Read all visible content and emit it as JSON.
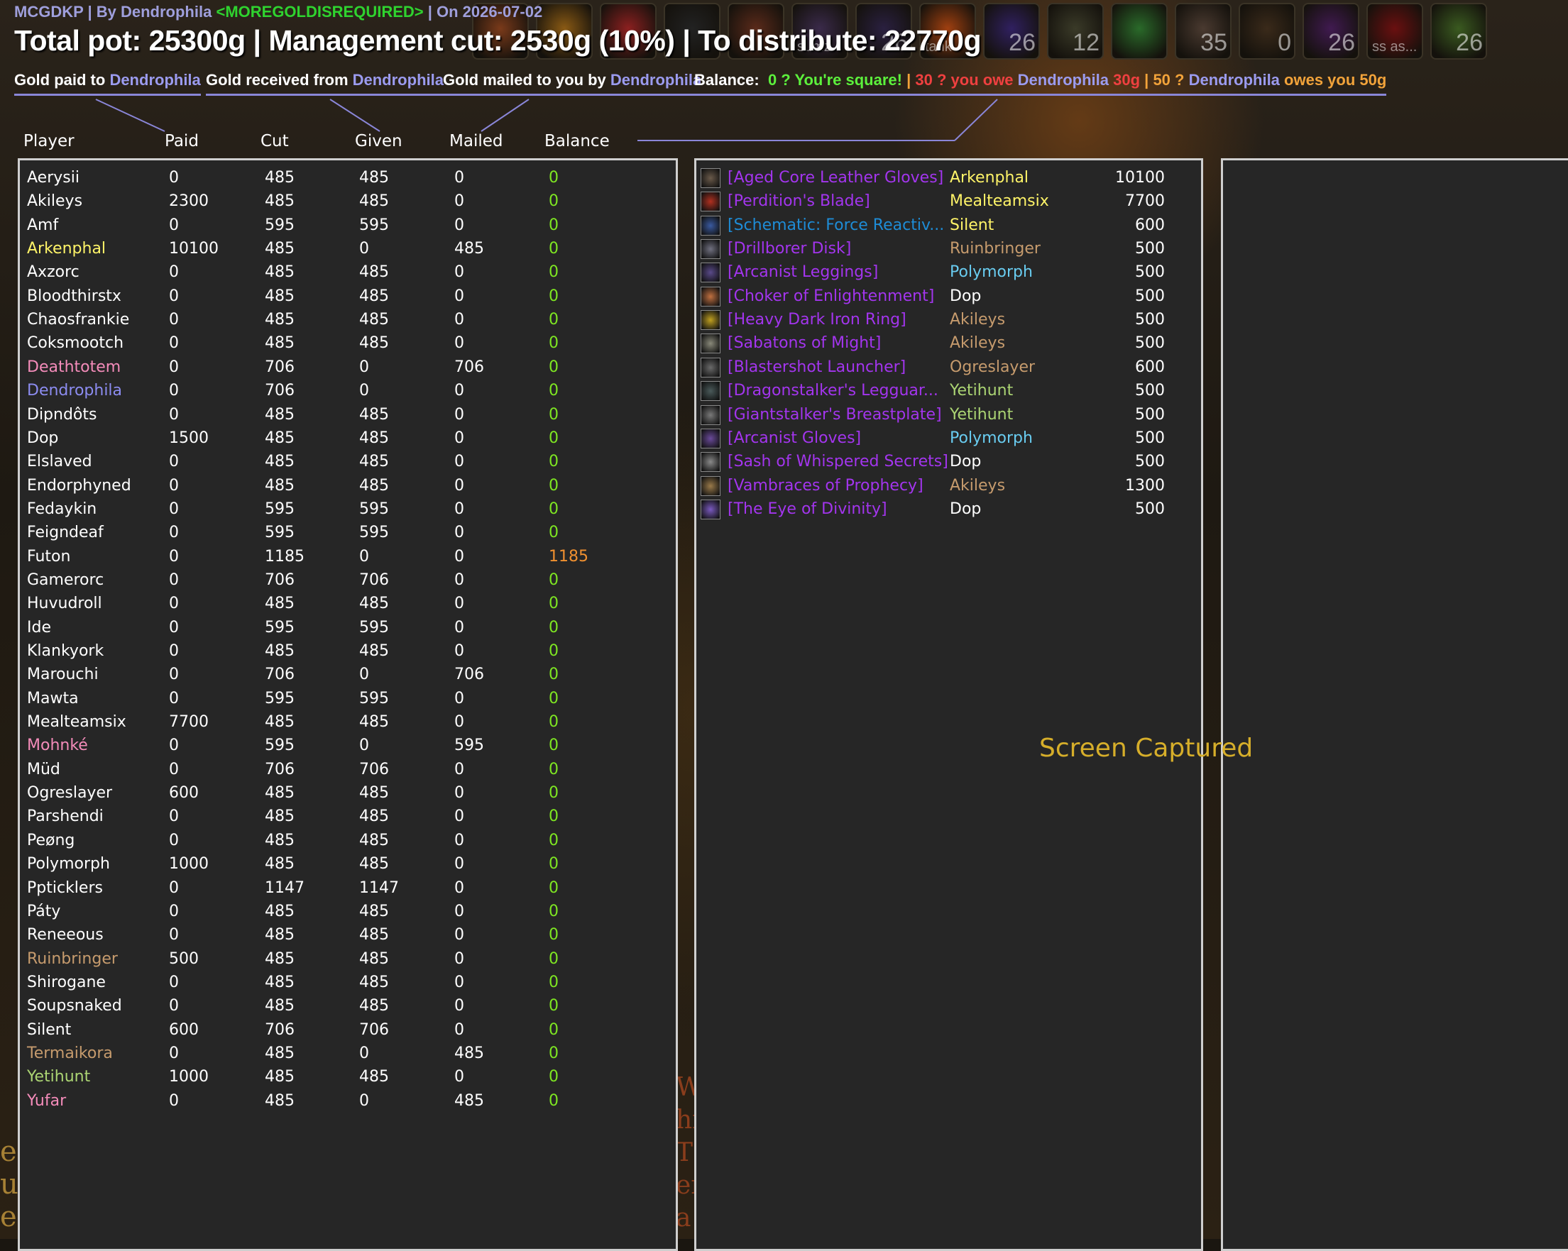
{
  "header": {
    "addon": "MCGDKP | By Dendrophila",
    "guild": "<MOREGOLDISREQUIRED>",
    "date": "| On 2026-07-02",
    "totals": "Total pot: 25300g | Management cut: 2530g (10%) | To distribute: 22770g"
  },
  "action_bar": [
    {
      "label": "",
      "tag": "",
      "color": "#7a3a1a"
    },
    {
      "label": "",
      "tag": "",
      "color": "#8a5a14"
    },
    {
      "label": "",
      "tag": "",
      "color": "#8c2020"
    },
    {
      "label": "",
      "tag": "",
      "color": "#222"
    },
    {
      "label": "",
      "tag": "",
      "color": "#5a2a1a"
    },
    {
      "label": "",
      "tag": "sumz",
      "color": "#3a2a4a"
    },
    {
      "label": "26",
      "tag": "",
      "color": "#2a2040"
    },
    {
      "label": "",
      "tag": "tank",
      "color": "#a04010"
    },
    {
      "label": "26",
      "tag": "",
      "color": "#302060"
    },
    {
      "label": "12",
      "tag": "",
      "color": "#3a3a28"
    },
    {
      "label": "",
      "tag": "",
      "color": "#2a6a2a"
    },
    {
      "label": "35",
      "tag": "",
      "color": "#4a3a30"
    },
    {
      "label": "0",
      "tag": "",
      "color": "#3a2a1a"
    },
    {
      "label": "26",
      "tag": "",
      "color": "#401a50"
    },
    {
      "label": "",
      "tag": "ss as...",
      "color": "#6a1010"
    },
    {
      "label": "26",
      "tag": "",
      "color": "#3a5a20"
    }
  ],
  "legend": {
    "paid_prefix": "Gold paid to ",
    "received_prefix": "Gold received from ",
    "mailed_prefix": "Gold mailed to you by ",
    "officer": "Dendrophila",
    "balance_label": "Balance:",
    "square": "0 ? You're square!",
    "sep": "|",
    "owe_a": "30 ? you owe ",
    "owe_b": " 30g",
    "owes_a": "50 ? ",
    "owes_b": " owes you 50g"
  },
  "columns": {
    "player": "Player",
    "paid": "Paid",
    "cut": "Cut",
    "given": "Given",
    "mailed": "Mailed",
    "balance": "Balance"
  },
  "players": [
    {
      "name": "Aerysii",
      "color": "#ffffff",
      "paid": "0",
      "cut": "485",
      "given": "485",
      "mailed": "0",
      "balance": "0"
    },
    {
      "name": "Akileys",
      "color": "#ffffff",
      "paid": "2300",
      "cut": "485",
      "given": "485",
      "mailed": "0",
      "balance": "0"
    },
    {
      "name": "Amf",
      "color": "#ffffff",
      "paid": "0",
      "cut": "595",
      "given": "595",
      "mailed": "0",
      "balance": "0"
    },
    {
      "name": "Arkenphal",
      "color": "#fff468",
      "paid": "10100",
      "cut": "485",
      "given": "0",
      "mailed": "485",
      "balance": "0"
    },
    {
      "name": "Axzorc",
      "color": "#ffffff",
      "paid": "0",
      "cut": "485",
      "given": "485",
      "mailed": "0",
      "balance": "0"
    },
    {
      "name": "Bloodthirstx",
      "color": "#ffffff",
      "paid": "0",
      "cut": "485",
      "given": "485",
      "mailed": "0",
      "balance": "0"
    },
    {
      "name": "Chaosfrankie",
      "color": "#ffffff",
      "paid": "0",
      "cut": "485",
      "given": "485",
      "mailed": "0",
      "balance": "0"
    },
    {
      "name": "Coksmootch",
      "color": "#ffffff",
      "paid": "0",
      "cut": "485",
      "given": "485",
      "mailed": "0",
      "balance": "0"
    },
    {
      "name": "Deathtotem",
      "color": "#f48cba",
      "paid": "0",
      "cut": "706",
      "given": "0",
      "mailed": "706",
      "balance": "0"
    },
    {
      "name": "Dendrophila",
      "color": "#8c8cf0",
      "paid": "0",
      "cut": "706",
      "given": "0",
      "mailed": "0",
      "balance": "0"
    },
    {
      "name": "Dipndôts",
      "color": "#ffffff",
      "paid": "0",
      "cut": "485",
      "given": "485",
      "mailed": "0",
      "balance": "0"
    },
    {
      "name": "Dop",
      "color": "#ffffff",
      "paid": "1500",
      "cut": "485",
      "given": "485",
      "mailed": "0",
      "balance": "0"
    },
    {
      "name": "Elslaved",
      "color": "#ffffff",
      "paid": "0",
      "cut": "485",
      "given": "485",
      "mailed": "0",
      "balance": "0"
    },
    {
      "name": "Endorphyned",
      "color": "#ffffff",
      "paid": "0",
      "cut": "485",
      "given": "485",
      "mailed": "0",
      "balance": "0"
    },
    {
      "name": "Fedaykin",
      "color": "#ffffff",
      "paid": "0",
      "cut": "595",
      "given": "595",
      "mailed": "0",
      "balance": "0"
    },
    {
      "name": "Feigndeaf",
      "color": "#ffffff",
      "paid": "0",
      "cut": "595",
      "given": "595",
      "mailed": "0",
      "balance": "0"
    },
    {
      "name": "Futon",
      "color": "#ffffff",
      "paid": "0",
      "cut": "1185",
      "given": "0",
      "mailed": "0",
      "balance": "1185"
    },
    {
      "name": "Gamerorc",
      "color": "#ffffff",
      "paid": "0",
      "cut": "706",
      "given": "706",
      "mailed": "0",
      "balance": "0"
    },
    {
      "name": "Huvudroll",
      "color": "#ffffff",
      "paid": "0",
      "cut": "485",
      "given": "485",
      "mailed": "0",
      "balance": "0"
    },
    {
      "name": "Ide",
      "color": "#ffffff",
      "paid": "0",
      "cut": "595",
      "given": "595",
      "mailed": "0",
      "balance": "0"
    },
    {
      "name": "Klankyork",
      "color": "#ffffff",
      "paid": "0",
      "cut": "485",
      "given": "485",
      "mailed": "0",
      "balance": "0"
    },
    {
      "name": "Marouchi",
      "color": "#ffffff",
      "paid": "0",
      "cut": "706",
      "given": "0",
      "mailed": "706",
      "balance": "0"
    },
    {
      "name": "Mawta",
      "color": "#ffffff",
      "paid": "0",
      "cut": "595",
      "given": "595",
      "mailed": "0",
      "balance": "0"
    },
    {
      "name": "Mealteamsix",
      "color": "#ffffff",
      "paid": "7700",
      "cut": "485",
      "given": "485",
      "mailed": "0",
      "balance": "0"
    },
    {
      "name": "Mohnké",
      "color": "#f48cba",
      "paid": "0",
      "cut": "595",
      "given": "0",
      "mailed": "595",
      "balance": "0"
    },
    {
      "name": "Müd",
      "color": "#ffffff",
      "paid": "0",
      "cut": "706",
      "given": "706",
      "mailed": "0",
      "balance": "0"
    },
    {
      "name": "Ogreslayer",
      "color": "#ffffff",
      "paid": "600",
      "cut": "485",
      "given": "485",
      "mailed": "0",
      "balance": "0"
    },
    {
      "name": "Parshendi",
      "color": "#ffffff",
      "paid": "0",
      "cut": "485",
      "given": "485",
      "mailed": "0",
      "balance": "0"
    },
    {
      "name": "Peøng",
      "color": "#ffffff",
      "paid": "0",
      "cut": "485",
      "given": "485",
      "mailed": "0",
      "balance": "0"
    },
    {
      "name": "Polymorph",
      "color": "#ffffff",
      "paid": "1000",
      "cut": "485",
      "given": "485",
      "mailed": "0",
      "balance": "0"
    },
    {
      "name": "Ppticklers",
      "color": "#ffffff",
      "paid": "0",
      "cut": "1147",
      "given": "1147",
      "mailed": "0",
      "balance": "0"
    },
    {
      "name": "Páty",
      "color": "#ffffff",
      "paid": "0",
      "cut": "485",
      "given": "485",
      "mailed": "0",
      "balance": "0"
    },
    {
      "name": "Reneeous",
      "color": "#ffffff",
      "paid": "0",
      "cut": "485",
      "given": "485",
      "mailed": "0",
      "balance": "0"
    },
    {
      "name": "Ruinbringer",
      "color": "#c69b6d",
      "paid": "500",
      "cut": "485",
      "given": "485",
      "mailed": "0",
      "balance": "0"
    },
    {
      "name": "Shirogane",
      "color": "#ffffff",
      "paid": "0",
      "cut": "485",
      "given": "485",
      "mailed": "0",
      "balance": "0"
    },
    {
      "name": "Soupsnaked",
      "color": "#ffffff",
      "paid": "0",
      "cut": "485",
      "given": "485",
      "mailed": "0",
      "balance": "0"
    },
    {
      "name": "Silent",
      "color": "#ffffff",
      "paid": "600",
      "cut": "706",
      "given": "706",
      "mailed": "0",
      "balance": "0"
    },
    {
      "name": "Termaikora",
      "color": "#c69b6d",
      "paid": "0",
      "cut": "485",
      "given": "0",
      "mailed": "485",
      "balance": "0"
    },
    {
      "name": "Yetihunt",
      "color": "#abd473",
      "paid": "1000",
      "cut": "485",
      "given": "485",
      "mailed": "0",
      "balance": "0"
    },
    {
      "name": "Yufar",
      "color": "#f48cba",
      "paid": "0",
      "cut": "485",
      "given": "0",
      "mailed": "485",
      "balance": "0"
    }
  ],
  "loot": [
    {
      "item": "[Aged Core Leather Gloves]",
      "item_color": "#a335ee",
      "winner": "Arkenphal",
      "winner_color": "#fff468",
      "price": "10100",
      "icon_color": "#6a5a4a"
    },
    {
      "item": "[Perdition's Blade]",
      "item_color": "#a335ee",
      "winner": "Mealteamsix",
      "winner_color": "#fff468",
      "price": "7700",
      "icon_color": "#b03020"
    },
    {
      "item": "[Schematic: Force Reactiv...",
      "item_color": "#1e8cd6",
      "winner": "Silent",
      "winner_color": "#fff468",
      "price": "600",
      "icon_color": "#3a5aa0"
    },
    {
      "item": "[Drillborer Disk]",
      "item_color": "#a335ee",
      "winner": "Ruinbringer",
      "winner_color": "#c69b6d",
      "price": "500",
      "icon_color": "#707080"
    },
    {
      "item": "[Arcanist Leggings]",
      "item_color": "#a335ee",
      "winner": "Polymorph",
      "winner_color": "#69ccf0",
      "price": "500",
      "icon_color": "#5a4a8a"
    },
    {
      "item": "[Choker of Enlightenment]",
      "item_color": "#a335ee",
      "winner": "Dop",
      "winner_color": "#ffffff",
      "price": "500",
      "icon_color": "#c07040"
    },
    {
      "item": "[Heavy Dark Iron Ring]",
      "item_color": "#a335ee",
      "winner": "Akileys",
      "winner_color": "#c69b6d",
      "price": "500",
      "icon_color": "#c0a020"
    },
    {
      "item": "[Sabatons of Might]",
      "item_color": "#a335ee",
      "winner": "Akileys",
      "winner_color": "#c69b6d",
      "price": "500",
      "icon_color": "#8a8a7a"
    },
    {
      "item": "[Blastershot Launcher]",
      "item_color": "#a335ee",
      "winner": "Ogreslayer",
      "winner_color": "#c69b6d",
      "price": "600",
      "icon_color": "#6a6a6a"
    },
    {
      "item": "[Dragonstalker's Legguar...",
      "item_color": "#a335ee",
      "winner": "Yetihunt",
      "winner_color": "#abd473",
      "price": "500",
      "icon_color": "#4a5a5a"
    },
    {
      "item": "[Giantstalker's Breastplate]",
      "item_color": "#a335ee",
      "winner": "Yetihunt",
      "winner_color": "#abd473",
      "price": "500",
      "icon_color": "#7a7a7a"
    },
    {
      "item": "[Arcanist Gloves]",
      "item_color": "#a335ee",
      "winner": "Polymorph",
      "winner_color": "#69ccf0",
      "price": "500",
      "icon_color": "#6a4a9a"
    },
    {
      "item": "[Sash of Whispered Secrets]",
      "item_color": "#a335ee",
      "winner": "Dop",
      "winner_color": "#ffffff",
      "price": "500",
      "icon_color": "#8a8a8a"
    },
    {
      "item": "[Vambraces of Prophecy]",
      "item_color": "#a335ee",
      "winner": "Akileys",
      "winner_color": "#c69b6d",
      "price": "1300",
      "icon_color": "#9a7a4a"
    },
    {
      "item": "[The Eye of Divinity]",
      "item_color": "#a335ee",
      "winner": "Dop",
      "winner_color": "#ffffff",
      "price": "500",
      "icon_color": "#7a5ac0"
    }
  ],
  "overlay": {
    "screen_captured": "Screen Captured"
  },
  "background_text": {
    "left": [
      "en",
      "u",
      "es"
    ],
    "mid": [
      "W",
      "hi",
      "T",
      "er",
      "a"
    ]
  }
}
